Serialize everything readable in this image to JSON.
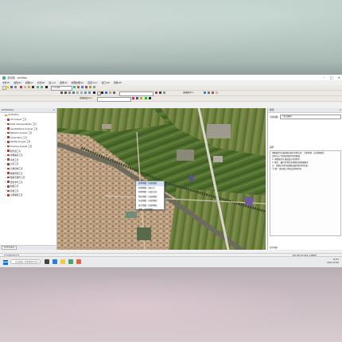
{
  "window": {
    "title": "无标题 - ArcMap"
  },
  "menu": [
    "文件(F)",
    "编辑(E)",
    "视图(V)",
    "书签(B)",
    "插入(I)",
    "选择(S)",
    "地理处理(G)",
    "自定义(C)",
    "窗口(W)",
    "帮助(H)"
  ],
  "toolbar": {
    "scale_value": "1:4,000",
    "georef_label": "地理配准(G) ▾",
    "layer_combo": "",
    "editor_label": "编辑器(R) ▾"
  },
  "toc": {
    "header": "ArcToolbox",
    "items": [
      {
        "label": "ArcToolbox",
        "root": true
      },
      {
        "label": "3D Analyst 工具"
      },
      {
        "label": "Data Interoperability 工具"
      },
      {
        "label": "Geostatistical Analyst 工具"
      },
      {
        "label": "Network Analyst 工具"
      },
      {
        "label": "Schematics 工具"
      },
      {
        "label": "Spatial Analyst 工具"
      },
      {
        "label": "Tracking Analyst 工具"
      },
      {
        "label": "服务器工具"
      },
      {
        "label": "地理编码工具"
      },
      {
        "label": "多维工具"
      },
      {
        "label": "分析工具"
      },
      {
        "label": "宗地结构工具"
      },
      {
        "label": "数据管理工具"
      },
      {
        "label": "数据互操作工具"
      },
      {
        "label": "线性参考工具"
      },
      {
        "label": "制图工具"
      },
      {
        "label": "转换工具"
      },
      {
        "label": "宗地编辑工具"
      }
    ],
    "footer_tab": "ArcToolbox"
  },
  "dropdown": {
    "items": [
      "影像地图（在线地图）",
      "影像地图（无标注）",
      "影像地图（在线注记）",
      "地形地图（在线地图）",
      "街道地图（在线地图）",
      "混合地图（在线地图）",
      "底图（在线地图）"
    ],
    "highlighted": 0
  },
  "right_panel": {
    "header": "搜索",
    "row_label": "当前视图",
    "select_value": "<默认模板>",
    "section_label": "说明",
    "description": [
      "地图服务在线底图来源有多种方式：卫星影像、街道地图等。",
      "请单击以下链接获取所需的数据：",
      "1. 地图服务在线加载方式(推荐)",
      "2. 服务 · 最新可用的天地图在线地图服务",
      "注：调整后的区域视图范围可能有所变化。",
      "\"注意:\" 当前窗口可能会受到影响。"
    ],
    "footer": "显示帮助"
  },
  "status": {
    "tab": "ArcToolbox",
    "coords": "115.324  37.219 十进制度"
  },
  "taskbar": {
    "search_placeholder": "在这里输入你要搜索的内容",
    "time": "10:51",
    "date": "2021/10/10"
  }
}
